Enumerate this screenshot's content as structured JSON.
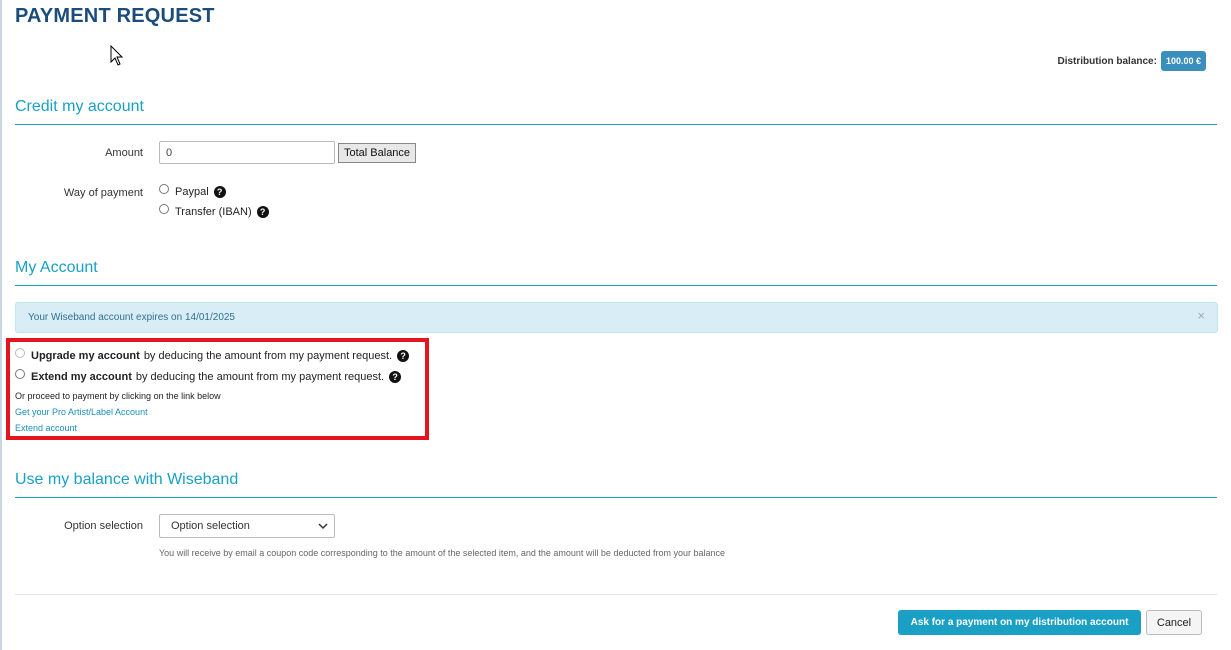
{
  "page": {
    "title": "PAYMENT REQUEST"
  },
  "balance": {
    "label": "Distribution balance:",
    "value": "100.00 €",
    "badge_color": "#3a8fbd"
  },
  "credit_section": {
    "title": "Credit my account",
    "amount_label": "Amount",
    "amount_value": "0",
    "total_balance_button": "Total Balance",
    "payment_label": "Way of payment",
    "payment_options": [
      "Paypal",
      "Transfer (IBAN)"
    ]
  },
  "account_section": {
    "title": "My Account",
    "alert_text": "Your Wiseband account expires on 14/01/2025",
    "alert_close": "×",
    "upgrade_bold": "Upgrade my account",
    "upgrade_rest": "by deducing the amount from my payment request.",
    "extend_bold": "Extend my account",
    "extend_rest": "by deducing the amount from my payment request.",
    "proceed_text": "Or proceed to payment by clicking on the link below",
    "link_pro": "Get your Pro Artist/Label Account",
    "link_extend": "Extend account"
  },
  "wiseband_section": {
    "title": "Use my balance with Wiseband",
    "option_label": "Option selection",
    "option_selected": "Option selection",
    "help_text": "You will receive by email a coupon code corresponding to the amount of the selected item, and the amount will be deducted from your balance"
  },
  "footer": {
    "submit_button": "Ask for a payment on my distribution account",
    "cancel_button": "Cancel"
  },
  "colors": {
    "accent": "#1aa0c4",
    "title": "#1b4c7a",
    "highlight": "#e3161f"
  },
  "icons": {
    "help": "question-circle-icon",
    "cursor": "mouse-pointer-icon",
    "chevron": "chevron-down-icon"
  }
}
